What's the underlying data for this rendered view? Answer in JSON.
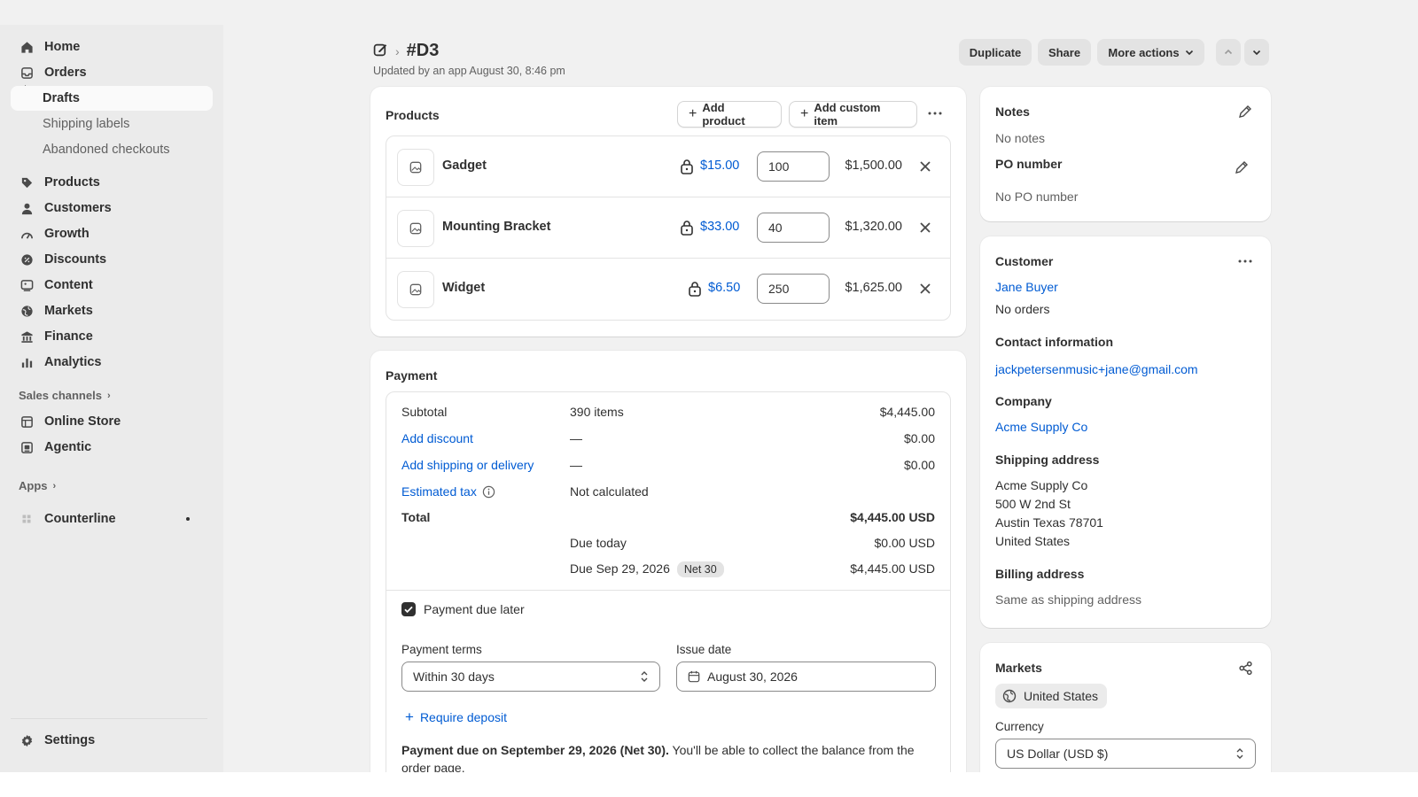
{
  "sidebar": {
    "items": [
      {
        "label": "Home",
        "icon": "home-icon"
      },
      {
        "label": "Orders",
        "icon": "orders-icon"
      },
      {
        "label": "Drafts"
      },
      {
        "label": "Shipping labels"
      },
      {
        "label": "Abandoned checkouts"
      },
      {
        "label": "Products",
        "icon": "tag-icon"
      },
      {
        "label": "Customers",
        "icon": "person-icon"
      },
      {
        "label": "Growth",
        "icon": "growth-icon"
      },
      {
        "label": "Discounts",
        "icon": "discount-icon"
      },
      {
        "label": "Content",
        "icon": "content-icon"
      },
      {
        "label": "Markets",
        "icon": "globe-icon"
      },
      {
        "label": "Finance",
        "icon": "bank-icon"
      },
      {
        "label": "Analytics",
        "icon": "bar-chart-icon"
      }
    ],
    "sales_channels_label": "Sales channels",
    "channels": [
      {
        "label": "Online Store",
        "icon": "store-icon"
      },
      {
        "label": "Agentic",
        "icon": "agent-icon"
      }
    ],
    "apps_label": "Apps",
    "apps": [
      {
        "label": "Counterline",
        "icon": "app-icon"
      }
    ],
    "settings_label": "Settings"
  },
  "header": {
    "title": "#D3",
    "subtitle": "Updated by an app August 30, 8:46 pm",
    "actions": {
      "duplicate": "Duplicate",
      "share": "Share",
      "more": "More actions"
    }
  },
  "products": {
    "title": "Products",
    "add_product": "Add product",
    "add_custom": "Add custom item",
    "items": [
      {
        "name": "Gadget",
        "price": "$15.00",
        "qty": "100",
        "total": "$1,500.00"
      },
      {
        "name": "Mounting Bracket",
        "price": "$33.00",
        "qty": "40",
        "total": "$1,320.00"
      },
      {
        "name": "Widget",
        "price": "$6.50",
        "qty": "250",
        "total": "$1,625.00"
      }
    ]
  },
  "payment": {
    "title": "Payment",
    "subtotal_label": "Subtotal",
    "subtotal_items": "390 items",
    "subtotal_value": "$4,445.00",
    "discount_label": "Add discount",
    "discount_dash": "—",
    "discount_value": "$0.00",
    "shipping_label": "Add shipping or delivery",
    "shipping_dash": "—",
    "shipping_value": "$0.00",
    "tax_label": "Estimated tax",
    "tax_status": "Not calculated",
    "total_label": "Total",
    "total_value": "$4,445.00 USD",
    "due_today_label": "Due today",
    "due_today_value": "$0.00 USD",
    "due_later_label": "Due Sep 29, 2026",
    "due_later_badge": "Net 30",
    "due_later_value": "$4,445.00 USD",
    "checkbox_label": "Payment due later",
    "terms_label": "Payment terms",
    "terms_value": "Within 30 days",
    "issue_label": "Issue date",
    "issue_value": "August 30, 2026",
    "deposit_label": "Require deposit",
    "note_bold": "Payment due on September 29, 2026 (Net 30).",
    "note_rest": " You'll be able to collect the balance from the",
    "note_line2": "order page."
  },
  "notes": {
    "title": "Notes",
    "value": "No notes",
    "po_title": "PO number",
    "po_value": "No PO number"
  },
  "customer": {
    "title": "Customer",
    "name": "Jane Buyer",
    "orders": "No orders",
    "contact_title": "Contact information",
    "email": "jackpetersenmusic+jane@gmail.com",
    "company_title": "Company",
    "company": "Acme Supply Co",
    "shipping_title": "Shipping address",
    "shipping_lines": [
      "Acme Supply Co",
      "500 W 2nd St",
      "Austin Texas 78701",
      "United States"
    ],
    "billing_title": "Billing address",
    "billing_value": "Same as shipping address"
  },
  "markets": {
    "title": "Markets",
    "market": "United States",
    "currency_label": "Currency",
    "currency_value": "US Dollar (USD $)"
  },
  "colors": {
    "accent": "#005bd3",
    "background": "#f1f1f1",
    "sidebar": "#ebebeb"
  }
}
